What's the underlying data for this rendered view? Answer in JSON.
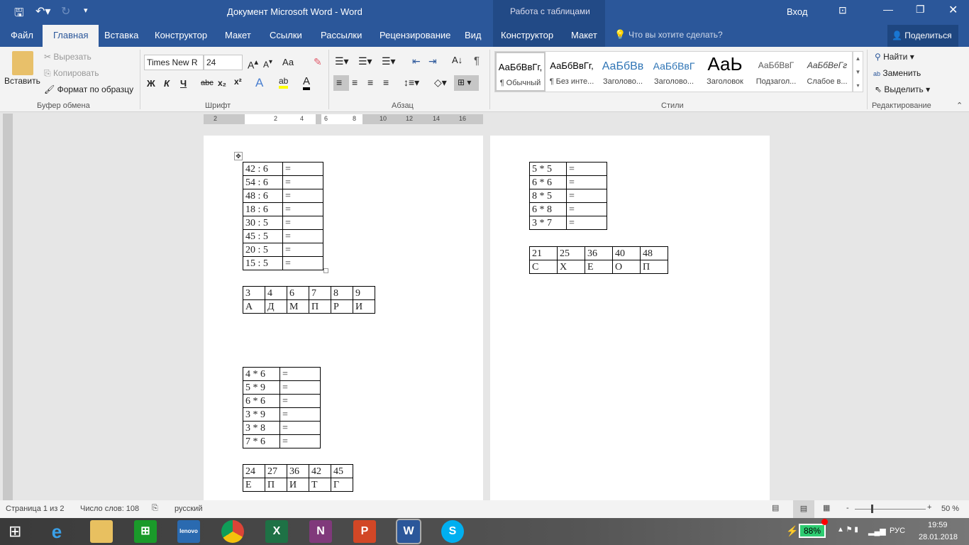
{
  "titlebar": {
    "title": "Документ Microsoft Word  -  Word",
    "context": "Работа с таблицами",
    "signin": "Вход"
  },
  "tabs": [
    "Файл",
    "Главная",
    "Вставка",
    "Конструктор",
    "Макет",
    "Ссылки",
    "Рассылки",
    "Рецензирование",
    "Вид",
    "Конструктор",
    "Макет"
  ],
  "tell_me": "Что вы хотите сделать?",
  "share": "Поделиться",
  "clipboard": {
    "paste": "Вставить",
    "cut": "Вырезать",
    "copy": "Копировать",
    "format_painter": "Формат по образцу",
    "group": "Буфер обмена"
  },
  "font": {
    "name": "Times New R",
    "size": "24",
    "group": "Шрифт",
    "bold": "Ж",
    "italic": "К",
    "underline": "Ч",
    "strike": "abc",
    "case": "Аа"
  },
  "paragraph": {
    "group": "Абзац"
  },
  "styles": {
    "group": "Стили",
    "items": [
      {
        "preview": "АаБбВвГг,",
        "name": "¶ Обычный"
      },
      {
        "preview": "АаБбВвГг,",
        "name": "¶ Без инте..."
      },
      {
        "preview": "АаБбВв",
        "name": "Заголово..."
      },
      {
        "preview": "АаБбВвГ",
        "name": "Заголово..."
      },
      {
        "preview": "АаЬ",
        "name": "Заголовок"
      },
      {
        "preview": "АаБбВвГ",
        "name": "Подзагол..."
      },
      {
        "preview": "АаБбВеГг",
        "name": "Слабое в..."
      }
    ]
  },
  "editing": {
    "find": "Найти",
    "replace": "Заменить",
    "select": "Выделить",
    "group": "Редактирование"
  },
  "ruler": [
    "2",
    "2",
    "4",
    "6",
    "8",
    "10",
    "12",
    "14",
    "16"
  ],
  "document": {
    "eq1": [
      [
        "42 : 6",
        "="
      ],
      [
        "54 : 6",
        "="
      ],
      [
        "48 : 6",
        "="
      ],
      [
        "18 : 6",
        "="
      ],
      [
        "30 : 5",
        "="
      ],
      [
        "45 : 5",
        "="
      ],
      [
        "20 : 5",
        "="
      ],
      [
        "15 : 5",
        "="
      ]
    ],
    "key1": [
      [
        "3",
        "4",
        "6",
        "7",
        "8",
        "9"
      ],
      [
        "А",
        "Д",
        "М",
        "П",
        "Р",
        "И"
      ]
    ],
    "eq2": [
      [
        "4 * 6",
        "="
      ],
      [
        "5 * 9",
        "="
      ],
      [
        "6 * 6",
        "="
      ],
      [
        "3 * 9",
        "="
      ],
      [
        "3 * 8",
        "="
      ],
      [
        "7 * 6",
        "="
      ]
    ],
    "key2": [
      [
        "24",
        "27",
        "36",
        "42",
        "45"
      ],
      [
        "Е",
        "П",
        "И",
        "Т",
        "Г"
      ]
    ],
    "eq3": [
      [
        "5 * 5",
        "="
      ],
      [
        "6 * 6",
        "="
      ],
      [
        "8 * 5",
        "="
      ],
      [
        "6 * 8",
        "="
      ],
      [
        "3 * 7",
        "="
      ]
    ],
    "key3": [
      [
        "21",
        "25",
        "36",
        "40",
        "48"
      ],
      [
        "С",
        "Х",
        "Е",
        "О",
        "П"
      ]
    ]
  },
  "status": {
    "page": "Страница 1 из 2",
    "words": "Число слов: 108",
    "language": "русский",
    "zoom": "50 %",
    "zoom_level": 50
  },
  "tray": {
    "battery": "88%",
    "lang": "РУС",
    "time": "19:59",
    "date": "28.01.2018"
  },
  "colors": {
    "accent": "#2b579a"
  }
}
